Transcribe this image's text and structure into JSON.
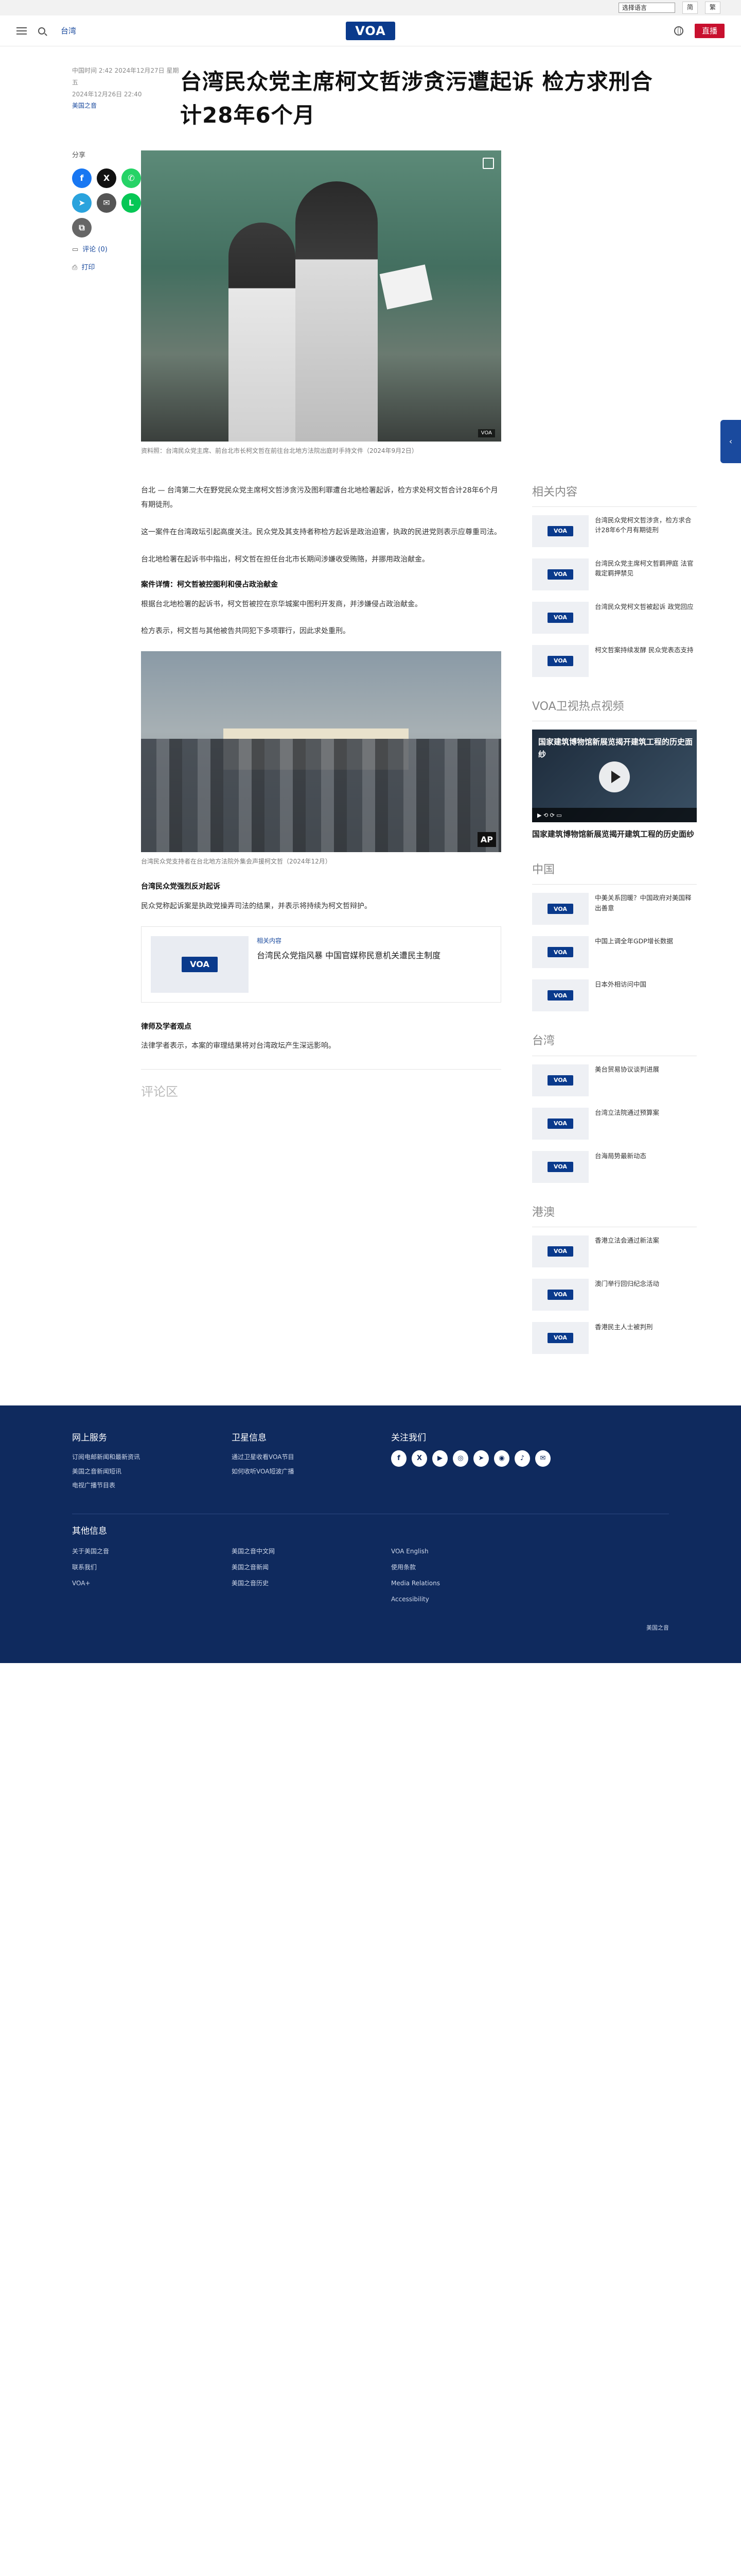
{
  "util": {
    "language": "选择语言",
    "btn1": "简",
    "btn2": "繁"
  },
  "header": {
    "section": "台湾",
    "logo": "VOA",
    "live": "直播"
  },
  "article": {
    "date_updated": "中国时间 2:42 2024年12月27日 星期五",
    "date_published": "2024年12月26日 22:40",
    "author": "美国之音",
    "title": "台湾民众党主席柯文哲涉贪污遭起诉 检方求刑合计28年6个月",
    "share_label": "分享",
    "comment_link": "评论 (0)",
    "print_link": "打印",
    "hero_caption": "资料照：台湾民众党主席、前台北市长柯文哲在前往台北地方法院出庭时手持文件（2024年9月2日）",
    "hero_credit": "VOA",
    "paragraphs": [
      "台北 — 台湾第二大在野党民众党主席柯文哲涉贪污及图利罪遭台北地检署起诉，检方求处柯文哲合计28年6个月有期徒刑。",
      "这一案件在台湾政坛引起高度关注。民众党及其支持者称检方起诉是政治迫害，执政的民进党则表示应尊重司法。",
      "台北地检署在起诉书中指出，柯文哲在担任台北市长期间涉嫌收受贿赂，并挪用政治献金。"
    ],
    "heading1": "案件详情：柯文哲被控图利和侵占政治献金",
    "paragraphs2": [
      "根据台北地检署的起诉书，柯文哲被控在京华城案中图利开发商，并涉嫌侵占政治献金。",
      "检方表示，柯文哲与其他被告共同犯下多项罪行，因此求处重刑。"
    ],
    "inline_caption": "台湾民众党支持者在台北地方法院外集会声援柯文哲（2024年12月）",
    "inline_credit": "AP",
    "heading2": "台湾民众党强烈反对起诉",
    "paragraphs3": [
      "民众党称起诉案是执政党操弄司法的结果，并表示将持续为柯文哲辩护。"
    ],
    "related_label": "相关内容",
    "related_title": "台湾民众党指风暴 中国官媒称民意机关遭民主制度",
    "heading3": "律师及学者观点",
    "paragraphs4": [
      "法律学者表示，本案的审理结果将对台湾政坛产生深远影响。"
    ],
    "comment_heading": "评论区"
  },
  "sidebar": {
    "related_heading": "相关内容",
    "related": [
      "台湾民众党柯文哲涉贪，检方求合计28年6个月有期徒刑",
      "台湾民众党主席柯文哲羁押庭 法官裁定羁押禁见",
      "台湾民众党柯文哲被起诉 政党回应",
      "柯文哲案持续发酵 民众党表态支持"
    ],
    "video_heading": "VOA卫视热点视频",
    "video_title": "国家建筑博物馆新展览揭开建筑工程的历史面纱",
    "video_caption": "国家建筑博物馆新展览揭开建筑工程的历史面纱",
    "china_heading": "中国",
    "china": [
      "中美关系回暖？中国政府对美国释出善意",
      "中国上调全年GDP增长数据",
      "日本外相访问中国"
    ],
    "taiwan_heading": "台湾",
    "taiwan": [
      "美台贸易协议谈判进展",
      "台湾立法院通过预算案",
      "台海局势最新动态"
    ],
    "hk_heading": "港澳",
    "hk": [
      "香港立法会通过新法案",
      "澳门举行回归纪念活动",
      "香港民主人士被判刑"
    ]
  },
  "footer": {
    "col1_heading": "网上服务",
    "col1": [
      "订阅电邮新闻和最新资讯",
      "美国之音新闻短讯",
      "电视广播节目表"
    ],
    "col2_heading": "卫星信息",
    "col2": [
      "通过卫星收看VOA节目",
      "如何收听VOA短波广播"
    ],
    "col3_heading": "关注我们",
    "more_heading": "其他信息",
    "grid": [
      "关于美国之音",
      "美国之音中文网",
      "VOA English",
      "联系我们",
      "美国之音新闻",
      "使用条款",
      "VOA+",
      "Media Relations",
      "美国之音历史",
      "Accessibility"
    ],
    "copyright": "美国之音"
  },
  "colors": {
    "brand": "#0a3a8c",
    "accent": "#c8102e",
    "footer_bg": "#0f2a5e"
  }
}
